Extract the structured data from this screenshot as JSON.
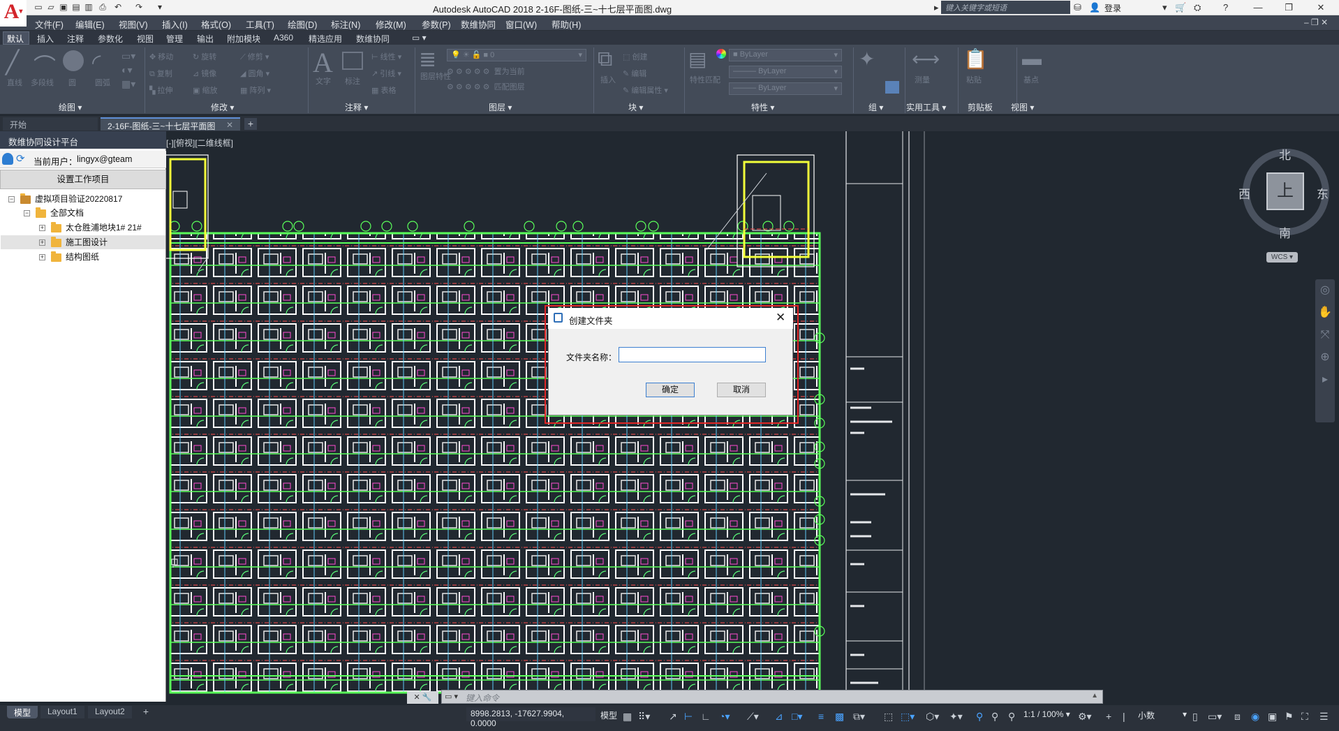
{
  "app": {
    "logo_letter": "A",
    "title": "Autodesk AutoCAD 2018    2-16F-图纸-三~十七层平面图.dwg",
    "search_placeholder": "键入关键字或短语",
    "login": "登录"
  },
  "menu": [
    "文件(F)",
    "编辑(E)",
    "视图(V)",
    "插入(I)",
    "格式(O)",
    "工具(T)",
    "绘图(D)",
    "标注(N)",
    "修改(M)",
    "参数(P)",
    "数维协同",
    "窗口(W)",
    "帮助(H)"
  ],
  "ribbon_tabs": [
    "默认",
    "插入",
    "注释",
    "参数化",
    "视图",
    "管理",
    "输出",
    "附加模块",
    "A360",
    "精选应用",
    "数维协同"
  ],
  "ribbon_panels": [
    "绘图",
    "修改",
    "注释",
    "图层",
    "块",
    "特性",
    "组",
    "实用工具",
    "剪贴板",
    "视图"
  ],
  "ribbon_items": {
    "draw": [
      "直线",
      "多段线",
      "圆",
      "圆弧"
    ],
    "modify": [
      "移动",
      "旋转",
      "修剪",
      "复制",
      "镜像",
      "圆角",
      "拉伸",
      "缩放",
      "阵列"
    ],
    "annotate": [
      "文字",
      "标注",
      "线性",
      "引线",
      "表格"
    ],
    "layer": [
      "图层特性",
      "置为当前",
      "匹配图层"
    ],
    "block": [
      "插入",
      "创建",
      "编辑",
      "编辑属性"
    ],
    "properties": [
      "特性匹配",
      "ByLayer",
      "ByLayer",
      "ByLayer"
    ],
    "utilities": [
      "测量"
    ],
    "clipboard": [
      "粘贴"
    ],
    "view": [
      "基点"
    ],
    "layer_value": "0"
  },
  "file_tabs": [
    "开始",
    "2-16F-图纸-三~十七层平面图"
  ],
  "palette": {
    "title": "数维协同设计平台",
    "current_user_label": "当前用户：",
    "current_user": "lingyx@gteam",
    "setup_button": "设置工作项目",
    "tree": {
      "root": "虚拟项目验证20220817",
      "docs": "全部文档",
      "folders": [
        "太仓胜浦地块1#  21#",
        "施工图设计",
        "结构图纸"
      ]
    }
  },
  "viewport_label": "[-][俯视][二维线框]",
  "viewcube": {
    "north": "北",
    "south": "南",
    "east": "东",
    "west": "西",
    "face": "上",
    "wcs": "WCS"
  },
  "dialog": {
    "title": "创建文件夹",
    "field_label": "文件夹名称：",
    "field_value": "",
    "ok": "确定",
    "cancel": "取消"
  },
  "command": {
    "placeholder": "键入命令"
  },
  "layout_tabs": [
    "模型",
    "Layout1",
    "Layout2"
  ],
  "status": {
    "coords": "8998.2813, -17627.9904, 0.0000",
    "mode": "模型",
    "scale": "1:1 / 100%",
    "units": "小数"
  }
}
